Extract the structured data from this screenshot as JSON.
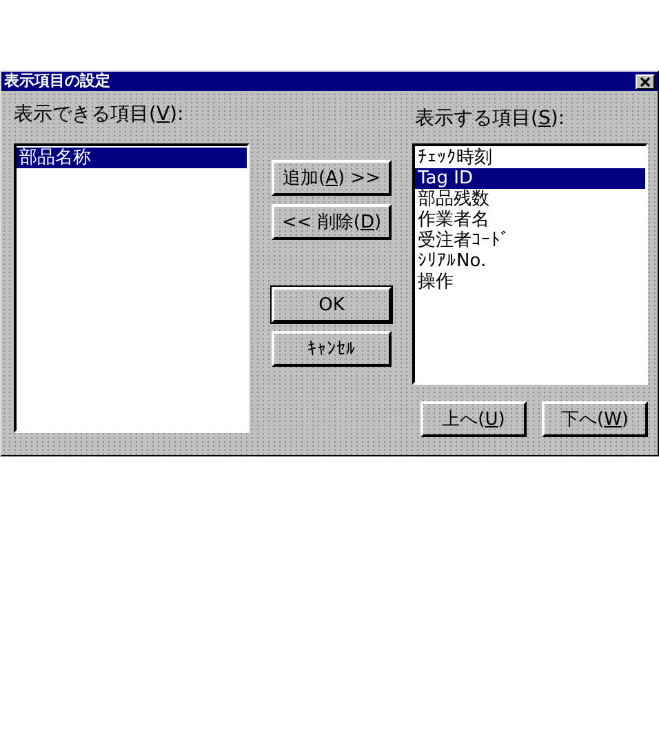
{
  "window": {
    "title": "表示項目の設定"
  },
  "available": {
    "label": {
      "before": "表示できる項目(",
      "key": "V",
      "after": "):"
    },
    "items": [
      {
        "text": "部品名称",
        "selected": true
      }
    ]
  },
  "actions": [
    {
      "before": "追加(",
      "key": "A",
      "after": ") >>",
      "default": false
    },
    {
      "before": "<< 削除(",
      "key": "D",
      "after": ")",
      "default": false
    },
    {
      "after": "OK",
      "default": true
    },
    {
      "after": "ｷｬﾝｾﾙ",
      "default": false
    }
  ],
  "shown": {
    "label": {
      "before": "表示する項目(",
      "key": "S",
      "after": "):"
    },
    "items": [
      {
        "text": "ﾁｪｯｸ時刻",
        "selected": false
      },
      {
        "text": "Tag ID",
        "selected": true
      },
      {
        "text": "部品残数",
        "selected": false
      },
      {
        "text": "作業者名",
        "selected": false
      },
      {
        "text": "受注者ｺｰﾄﾞ",
        "selected": false
      },
      {
        "text": "ｼﾘｱﾙNo.",
        "selected": false
      },
      {
        "text": "操作",
        "selected": false
      }
    ]
  },
  "order_buttons": [
    {
      "before": "上へ(",
      "key": "U",
      "after": ")"
    },
    {
      "before": "下へ(",
      "key": "W",
      "after": ")"
    }
  ]
}
